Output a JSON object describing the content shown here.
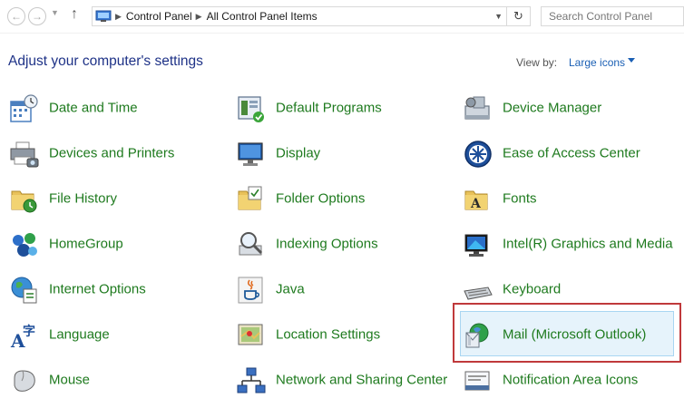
{
  "address": {
    "crumbs": [
      "Control Panel",
      "All Control Panel Items"
    ],
    "search_placeholder": "Search Control Panel"
  },
  "header": {
    "title": "Adjust your computer's settings",
    "view_by_label": "View by:",
    "view_by_value": "Large icons"
  },
  "items": [
    {
      "label": "Date and Time"
    },
    {
      "label": "Default Programs"
    },
    {
      "label": "Device Manager"
    },
    {
      "label": "Devices and Printers"
    },
    {
      "label": "Display"
    },
    {
      "label": "Ease of Access Center"
    },
    {
      "label": "File History"
    },
    {
      "label": "Folder Options"
    },
    {
      "label": "Fonts"
    },
    {
      "label": "HomeGroup"
    },
    {
      "label": "Indexing Options"
    },
    {
      "label": "Intel(R) Graphics and Media"
    },
    {
      "label": "Internet Options"
    },
    {
      "label": "Java"
    },
    {
      "label": "Keyboard"
    },
    {
      "label": "Language"
    },
    {
      "label": "Location Settings"
    },
    {
      "label": "Mail (Microsoft Outlook)"
    },
    {
      "label": "Mouse"
    },
    {
      "label": "Network and Sharing Center"
    },
    {
      "label": "Notification Area Icons"
    }
  ],
  "colors": {
    "link_green": "#1e7a1e",
    "heading_blue": "#1e3287",
    "highlight_red": "#c0393b"
  }
}
